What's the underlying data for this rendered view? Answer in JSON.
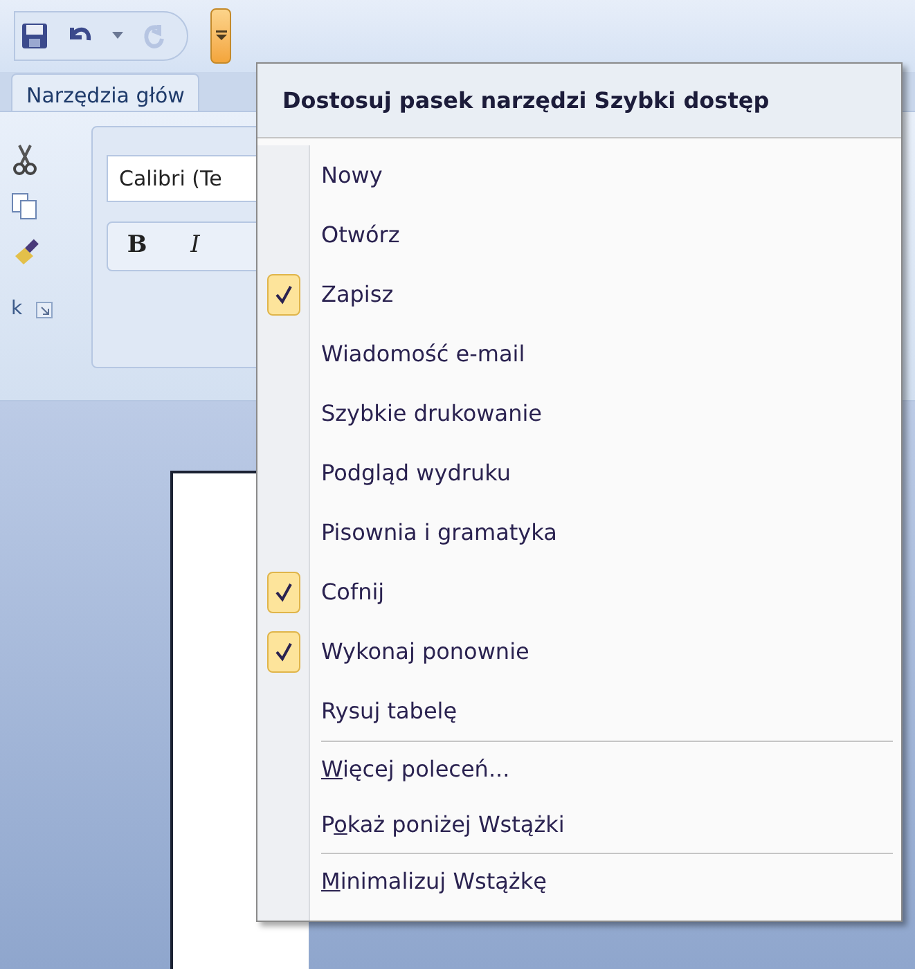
{
  "quick_access": [
    {
      "kind": "save",
      "disabled": false
    },
    {
      "kind": "undo",
      "disabled": false
    },
    {
      "kind": "dropdown",
      "disabled": false
    },
    {
      "kind": "redo",
      "disabled": true
    },
    {
      "kind": "customize",
      "disabled": false
    }
  ],
  "ribbon": {
    "tab": "Narzędzia głów",
    "font_box": "Calibri (Te",
    "bold": "B",
    "italic": "I",
    "group_label": "k"
  },
  "menu": {
    "title": "Dostosuj pasek narzędzi Szybki dostęp",
    "items": [
      {
        "kind": "command",
        "label": "Nowy",
        "checked": false
      },
      {
        "kind": "command",
        "label": "Otwórz",
        "checked": false
      },
      {
        "kind": "command",
        "label": "Zapisz",
        "checked": true
      },
      {
        "kind": "command",
        "label": "Wiadomość e-mail",
        "checked": false
      },
      {
        "kind": "command",
        "label": "Szybkie drukowanie",
        "checked": false
      },
      {
        "kind": "command",
        "label": "Podgląd wydruku",
        "checked": false
      },
      {
        "kind": "command",
        "label": "Pisownia i gramatyka",
        "checked": false
      },
      {
        "kind": "command",
        "label": "Cofnij",
        "checked": true
      },
      {
        "kind": "command",
        "label": "Wykonaj ponownie",
        "checked": true
      },
      {
        "kind": "command",
        "label": "Rysuj tabelę",
        "checked": false
      },
      {
        "kind": "option",
        "key": "W",
        "after": "ięcej poleceń...",
        "separator_before": true
      },
      {
        "kind": "option",
        "before": "P",
        "key": "o",
        "after": "każ poniżej Wstążki",
        "separator_before": false
      },
      {
        "kind": "option",
        "key": "M",
        "after": "inimalizuj Wstążkę",
        "separator_before": true
      }
    ]
  }
}
